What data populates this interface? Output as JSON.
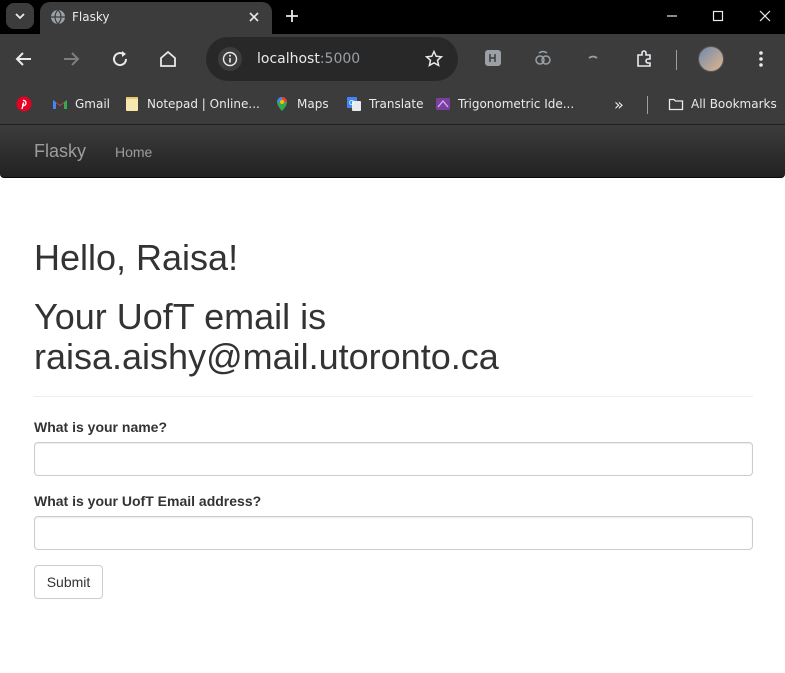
{
  "browser": {
    "tab": {
      "title": "Flasky"
    },
    "omnibox": {
      "host": "localhost",
      "port": ":5000"
    },
    "bookmarks": [
      {
        "label": "",
        "icon": "pinterest-icon"
      },
      {
        "label": "Gmail",
        "icon": "gmail-icon"
      },
      {
        "label": "Notepad | Online...",
        "icon": "notepad-icon"
      },
      {
        "label": "Maps",
        "icon": "maps-icon"
      },
      {
        "label": "Translate",
        "icon": "translate-icon"
      },
      {
        "label": "Trigonometric Ide...",
        "icon": "trig-icon"
      }
    ],
    "more_bookmarks": "»",
    "all_bookmarks": "All Bookmarks"
  },
  "navbar": {
    "brand": "Flasky",
    "home": "Home"
  },
  "main": {
    "greeting": "Hello, Raisa!",
    "email_line1": "Your UofT email is",
    "email_line2": "raisa.aishy@mail.utoronto.ca"
  },
  "form": {
    "name_label": "What is your name?",
    "name_value": "",
    "email_label": "What is your UofT Email address?",
    "email_value": "",
    "submit_label": "Submit"
  },
  "colors": {
    "chrome_bg": "#3c3c3c",
    "tabstrip_bg": "#000000",
    "navbar_bg": "#222222",
    "text": "#333333"
  }
}
